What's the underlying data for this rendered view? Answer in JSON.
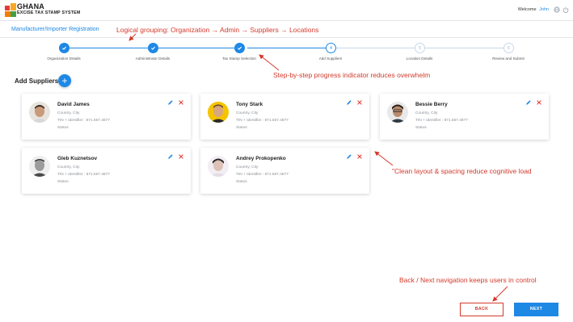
{
  "header": {
    "logo_line1": "GHANA",
    "logo_line2": "EXCISE TAX STAMP SYSTEM",
    "welcome": "Welcome",
    "user": "John",
    "icons": [
      "globe-icon",
      "power-icon"
    ]
  },
  "page_title": "Manufacturer/Importer Registration",
  "stepper": {
    "steps": [
      {
        "label": "Organization Details",
        "status": "done"
      },
      {
        "label": "Administrator Details",
        "status": "done"
      },
      {
        "label": "Tax Stamp Selection",
        "status": "done"
      },
      {
        "label": "Add Suppliers",
        "status": "current",
        "number": "4"
      },
      {
        "label": "Location Details",
        "status": "todo",
        "number": "5"
      },
      {
        "label": "Review and Submit",
        "status": "todo",
        "number": "6"
      }
    ]
  },
  "suppliers_section": {
    "title": "Add Suppliers",
    "add_label": "+"
  },
  "suppliers": [
    {
      "name": "David James",
      "location": "Country, City",
      "tin": "TIN + Identifier : 871.567.4877",
      "status": "Status"
    },
    {
      "name": "Tony Stark",
      "location": "Country, City",
      "tin": "TIN + Identifier : 871.567.4877",
      "status": "Status"
    },
    {
      "name": "Bessie Berry",
      "location": "Country, City",
      "tin": "TIN + Identifier : 871.567.4877",
      "status": "Status"
    },
    {
      "name": "Gleb Kuznetsov",
      "location": "Country, City",
      "tin": "TIN + Identifier : 871.567.4877",
      "status": "Status"
    },
    {
      "name": "Andrey Prokopenko",
      "location": "Country, City",
      "tin": "TIN + Identifier : 871.567.4877",
      "status": "Status"
    }
  ],
  "annotations": {
    "grouping": "Logical grouping: Organization → Admin → Suppliers → Locations",
    "progress": "Step-by-step progress indicator reduces overwhelm",
    "layout": "\"Clean layout & spacing reduce cognitive load",
    "navigation": "Back / Next navigation keeps users in control"
  },
  "buttons": {
    "back": "BACK",
    "next": "NEXT"
  },
  "colors": {
    "accent": "#1e88e5",
    "annotation": "#d23a2c",
    "delete": "#e53935"
  }
}
